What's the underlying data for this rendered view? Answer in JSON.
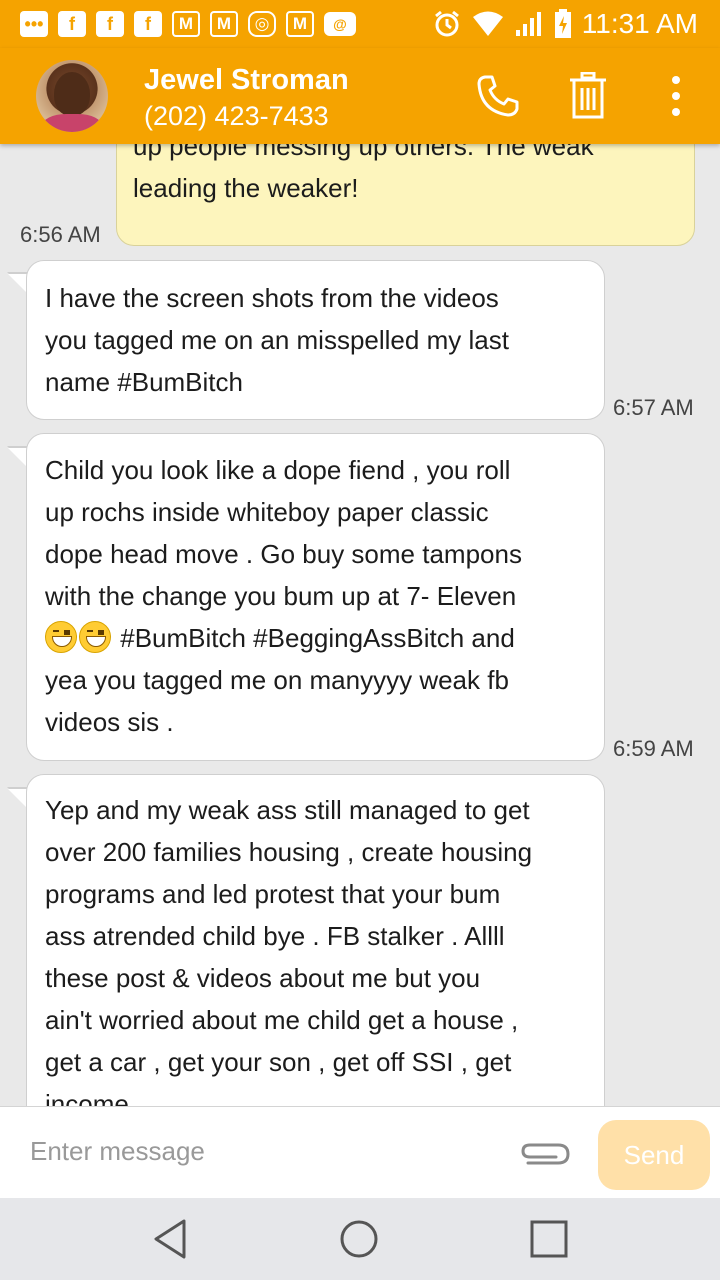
{
  "status_bar": {
    "time": "11:31 AM",
    "notification_icons": [
      "chat-bubble-icon",
      "facebook-icon",
      "facebook-icon",
      "facebook-icon",
      "gmail-icon",
      "gmail-icon",
      "instagram-icon",
      "gmail-icon",
      "email-icon"
    ],
    "system_icons": [
      "alarm-icon",
      "wifi-icon",
      "signal-icon",
      "battery-icon"
    ]
  },
  "header": {
    "name": "Jewel Stroman",
    "phone": "(202) 423-7433",
    "icons": [
      "phone-icon",
      "trash-icon",
      "more-vertical-icon"
    ]
  },
  "messages": [
    {
      "direction": "outgoing",
      "lines": [
        "up people messing up others. The weak",
        "leading the weaker!"
      ],
      "time": "6:56 AM"
    },
    {
      "direction": "incoming",
      "lines": [
        "I have the screen shots from the videos",
        "you tagged me on an misspelled my last",
        "name #BumBitch"
      ],
      "time": "6:57 AM"
    },
    {
      "direction": "incoming",
      "lines": [
        "Child you look like a dope fiend , you roll",
        "up rochs inside whiteboy paper classic",
        "dope head move . Go buy some tampons",
        "with the change you bum up at 7- Eleven",
        "#BumBitch #BeggingAssBitch and",
        "yea you tagged me on manyyyy weak fb",
        "videos sis ."
      ],
      "emoji_icon": "grinning-face-emoji",
      "time": "6:59 AM"
    },
    {
      "direction": "incoming",
      "lines": [
        "Yep and my weak ass still managed to get",
        "over 200 families housing , create housing",
        "programs and led protest that your bum",
        "ass atrended child bye . FB stalker . Allll",
        "these post & videos about me but you",
        "ain't worried about me child get a house ,",
        "get a car , get your son , get off SSI , get",
        "income"
      ]
    }
  ],
  "composer": {
    "placeholder": "Enter message",
    "send_label": "Send"
  },
  "nav": [
    "back-icon",
    "home-icon",
    "recents-icon"
  ],
  "colors": {
    "accent": "#f5a300",
    "outgoing_bubble": "#fdf5bd",
    "incoming_bubble": "#ffffff",
    "send_disabled": "#ffe0a8"
  }
}
